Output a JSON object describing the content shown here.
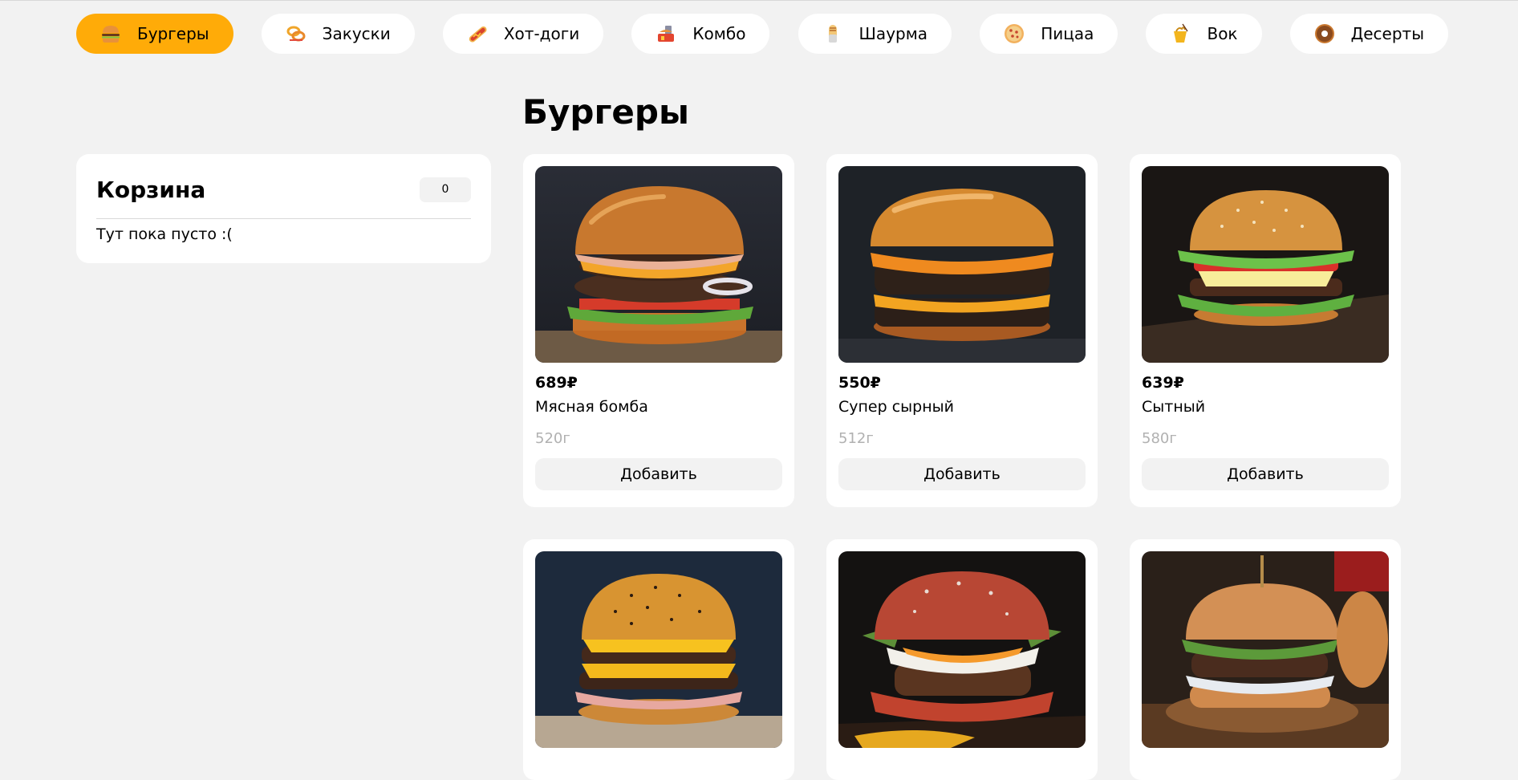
{
  "nav": {
    "items": [
      {
        "label": "Бургеры",
        "icon": "burger-icon",
        "active": true
      },
      {
        "label": "Закуски",
        "icon": "onion-rings-icon",
        "active": false
      },
      {
        "label": "Хот-доги",
        "icon": "hot-dog-icon",
        "active": false
      },
      {
        "label": "Комбо",
        "icon": "combo-icon",
        "active": false
      },
      {
        "label": "Шаурма",
        "icon": "shawarma-icon",
        "active": false
      },
      {
        "label": "Пицаа",
        "icon": "pizza-icon",
        "active": false
      },
      {
        "label": "Вок",
        "icon": "wok-icon",
        "active": false
      },
      {
        "label": "Десерты",
        "icon": "donut-icon",
        "active": false
      }
    ]
  },
  "cart": {
    "title": "Корзина",
    "count": "0",
    "empty_text": "Тут пока пусто :("
  },
  "main": {
    "title": "Бургеры",
    "products": [
      {
        "price": "689₽",
        "name": "Мясная бомба",
        "weight": "520г",
        "button": "Добавить"
      },
      {
        "price": "550₽",
        "name": "Супер сырный",
        "weight": "512г",
        "button": "Добавить"
      },
      {
        "price": "639₽",
        "name": "Сытный",
        "weight": "580г",
        "button": "Добавить"
      },
      {
        "price": "",
        "name": "",
        "weight": "",
        "button": ""
      },
      {
        "price": "",
        "name": "",
        "weight": "",
        "button": ""
      },
      {
        "price": "",
        "name": "",
        "weight": "",
        "button": ""
      }
    ]
  },
  "colors": {
    "accent": "#ffab08",
    "background": "#f2f2f2",
    "card": "#ffffff",
    "muted_text": "#b1b1b1"
  }
}
